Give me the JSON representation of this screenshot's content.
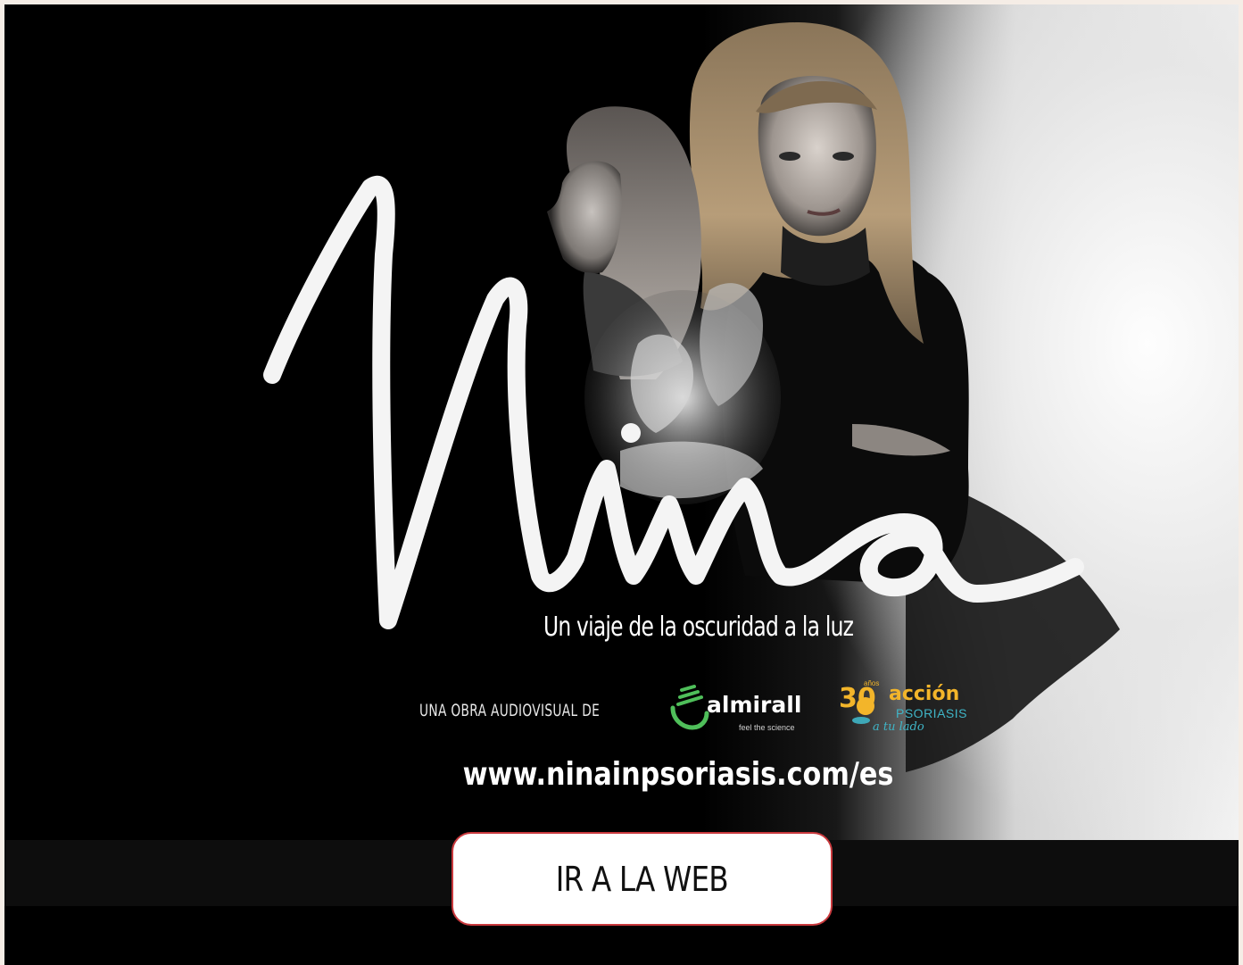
{
  "poster": {
    "title": "Nina",
    "tagline": "Un viaje de la oscuridad a la luz",
    "credit_text": "UNA OBRA AUDIOVISUAL DE",
    "url": "www.ninainpsoriasis.com/es"
  },
  "almirall": {
    "name": "almirall",
    "slogan": "feel the science"
  },
  "accion": {
    "number": "30",
    "years": "años",
    "name": "acción",
    "sub": "PSORIASIS",
    "tagline": "a tu lado"
  },
  "cta": {
    "label": "IR A LA WEB"
  },
  "colors": {
    "cta_border": "#c9393d",
    "accion_yellow": "#f3b52a",
    "accion_teal": "#3fb5c7",
    "almirall_green": "#4fbf5a"
  }
}
